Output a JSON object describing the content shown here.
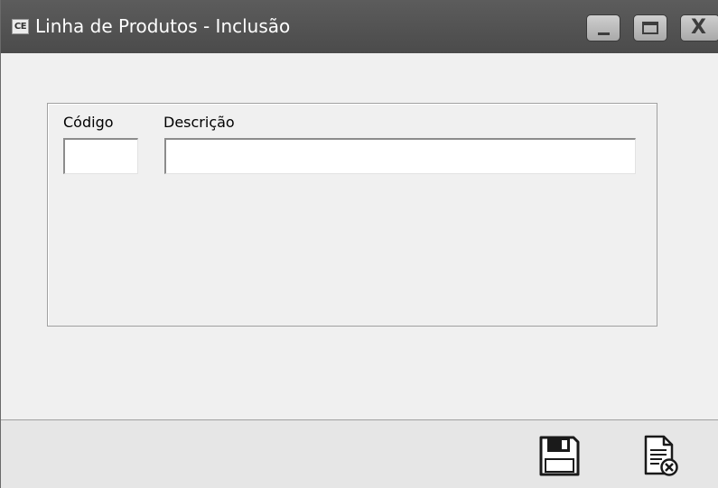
{
  "window": {
    "app_icon_label": "CE",
    "title": "Linha de Produtos - Inclusão",
    "controls": {
      "minimize_icon": "minimize-icon",
      "maximize_icon": "maximize-icon",
      "close_icon": "close-icon",
      "close_glyph": "X"
    }
  },
  "form": {
    "codigo_label": "Código",
    "codigo_value": "",
    "descricao_label": "Descrição",
    "descricao_value": ""
  },
  "toolbar": {
    "save_icon": "floppy-disk-icon",
    "cancel_icon": "document-cancel-icon"
  },
  "colors": {
    "titlebar": "#545454",
    "window_bg": "#f0f0f0",
    "footer_bg": "#e6e6e6"
  }
}
